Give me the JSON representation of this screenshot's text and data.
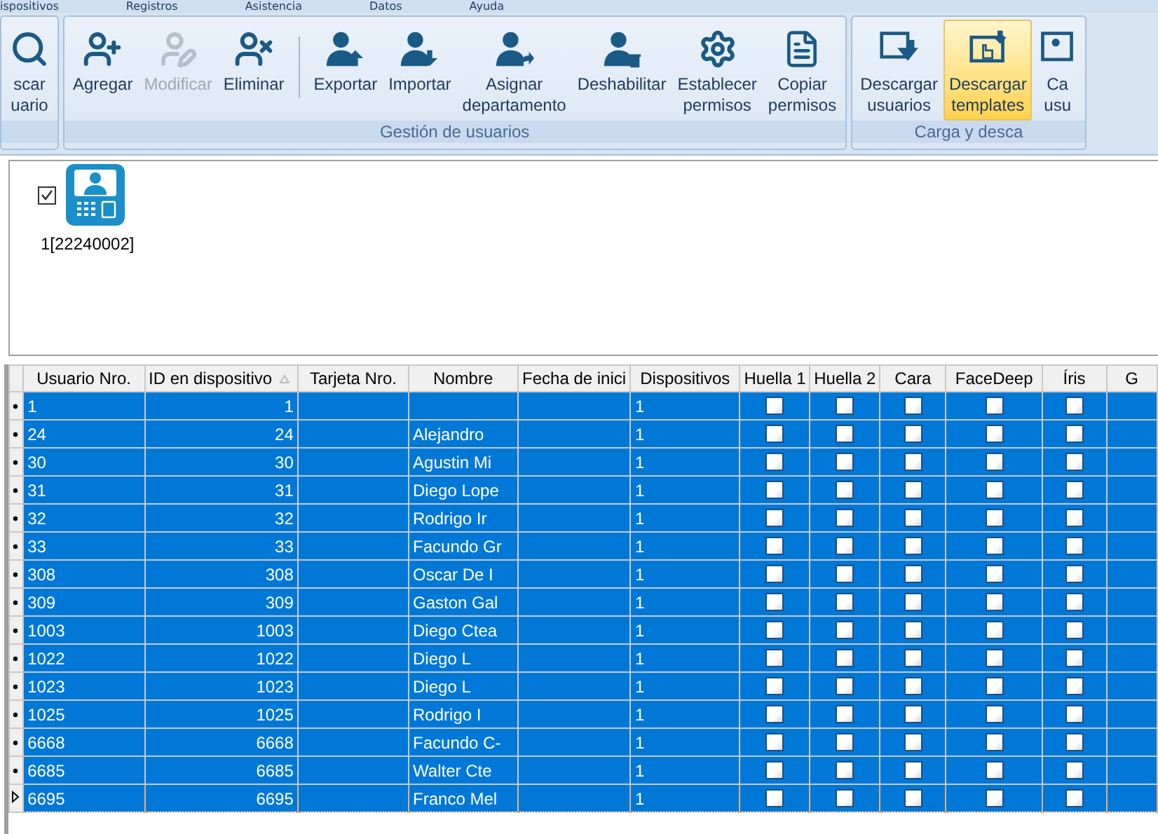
{
  "menu": [
    "ispositivos",
    "Registros",
    "Asistencia",
    "Datos",
    "Ayuda"
  ],
  "ribbon_groups": [
    {
      "buttons": [
        {
          "lines": [
            "scar",
            "uario"
          ],
          "disabled": false,
          "selected": false
        }
      ]
    },
    {
      "label": "Gestión de usuarios",
      "buttons": [
        {
          "lines": [
            "Agregar"
          ],
          "disabled": false,
          "selected": false,
          "divider_after": false
        },
        {
          "lines": [
            "Modificar"
          ],
          "disabled": true,
          "selected": false,
          "divider_after": false
        },
        {
          "lines": [
            "Eliminar"
          ],
          "disabled": false,
          "selected": false,
          "divider_after": true
        },
        {
          "lines": [
            "Exportar"
          ],
          "disabled": false,
          "selected": false,
          "divider_after": false
        },
        {
          "lines": [
            "Importar"
          ],
          "disabled": false,
          "selected": false,
          "divider_after": false
        },
        {
          "lines": [
            "Asignar",
            "departamento"
          ],
          "disabled": false,
          "selected": false,
          "divider_after": false
        },
        {
          "lines": [
            "Deshabilitar"
          ],
          "disabled": false,
          "selected": false,
          "divider_after": false
        },
        {
          "lines": [
            "Establecer",
            "permisos"
          ],
          "disabled": false,
          "selected": false,
          "divider_after": false
        },
        {
          "lines": [
            "Copiar",
            "permisos"
          ],
          "disabled": false,
          "selected": false,
          "divider_after": false
        }
      ]
    },
    {
      "label": "Carga y desca",
      "buttons": [
        {
          "lines": [
            "Descargar",
            "usuarios"
          ],
          "disabled": false,
          "selected": false
        },
        {
          "lines": [
            "Descargar",
            "templates"
          ],
          "disabled": false,
          "selected": true
        },
        {
          "lines": [
            "Ca",
            "usu"
          ],
          "disabled": false,
          "selected": false
        }
      ]
    }
  ],
  "devices": [
    {
      "label": "1[22240002]",
      "checked": true
    }
  ],
  "table": {
    "columns": [
      "Usuario Nro.",
      "ID en dispositivo",
      "Tarjeta Nro.",
      "Nombre",
      "Fecha de inici",
      "Dispositivos",
      "Huella 1",
      "Huella 2",
      "Cara",
      "FaceDeep",
      "Íris",
      "G"
    ],
    "rows": [
      {
        "cells": [
          "1",
          "1",
          "",
          "",
          "",
          "1"
        ],
        "flags": [
          false,
          false,
          false,
          false,
          false
        ],
        "current": false,
        "selected": true
      },
      {
        "cells": [
          "24",
          "24",
          "",
          "Alejandro",
          "",
          "1"
        ],
        "flags": [
          false,
          false,
          false,
          false,
          false
        ],
        "current": false,
        "selected": true
      },
      {
        "cells": [
          "30",
          "30",
          "",
          "Agustin Mi",
          "",
          "1"
        ],
        "flags": [
          false,
          false,
          false,
          false,
          false
        ],
        "current": false,
        "selected": true
      },
      {
        "cells": [
          "31",
          "31",
          "",
          "Diego Lope",
          "",
          "1"
        ],
        "flags": [
          false,
          false,
          false,
          false,
          false
        ],
        "current": false,
        "selected": true
      },
      {
        "cells": [
          "32",
          "32",
          "",
          "Rodrigo Ir",
          "",
          "1"
        ],
        "flags": [
          false,
          false,
          false,
          false,
          false
        ],
        "current": false,
        "selected": true
      },
      {
        "cells": [
          "33",
          "33",
          "",
          "Facundo Gr",
          "",
          "1"
        ],
        "flags": [
          false,
          false,
          false,
          false,
          false
        ],
        "current": false,
        "selected": true
      },
      {
        "cells": [
          "308",
          "308",
          "",
          "Oscar De I",
          "",
          "1"
        ],
        "flags": [
          false,
          false,
          false,
          false,
          false
        ],
        "current": false,
        "selected": true
      },
      {
        "cells": [
          "309",
          "309",
          "",
          "Gaston Gal",
          "",
          "1"
        ],
        "flags": [
          false,
          false,
          false,
          false,
          false
        ],
        "current": false,
        "selected": true
      },
      {
        "cells": [
          "1003",
          "1003",
          "",
          "Diego Ctea",
          "",
          "1"
        ],
        "flags": [
          false,
          false,
          false,
          false,
          false
        ],
        "current": false,
        "selected": true
      },
      {
        "cells": [
          "1022",
          "1022",
          "",
          "Diego L",
          "",
          "1"
        ],
        "flags": [
          false,
          false,
          false,
          false,
          false
        ],
        "current": false,
        "selected": true
      },
      {
        "cells": [
          "1023",
          "1023",
          "",
          "Diego L",
          "",
          "1"
        ],
        "flags": [
          false,
          false,
          false,
          false,
          false
        ],
        "current": false,
        "selected": true
      },
      {
        "cells": [
          "1025",
          "1025",
          "",
          "Rodrigo I",
          "",
          "1"
        ],
        "flags": [
          false,
          false,
          false,
          false,
          false
        ],
        "current": false,
        "selected": true
      },
      {
        "cells": [
          "6668",
          "6668",
          "",
          "Facundo C-",
          "",
          "1"
        ],
        "flags": [
          false,
          false,
          false,
          false,
          false
        ],
        "current": false,
        "selected": true
      },
      {
        "cells": [
          "6685",
          "6685",
          "",
          "Walter Cte",
          "",
          "1"
        ],
        "flags": [
          false,
          false,
          false,
          false,
          false
        ],
        "current": false,
        "selected": true
      },
      {
        "cells": [
          "6695",
          "6695",
          "",
          "Franco Mel",
          "",
          "1"
        ],
        "flags": [
          false,
          false,
          false,
          false,
          false
        ],
        "current": true,
        "selected": true
      }
    ]
  }
}
